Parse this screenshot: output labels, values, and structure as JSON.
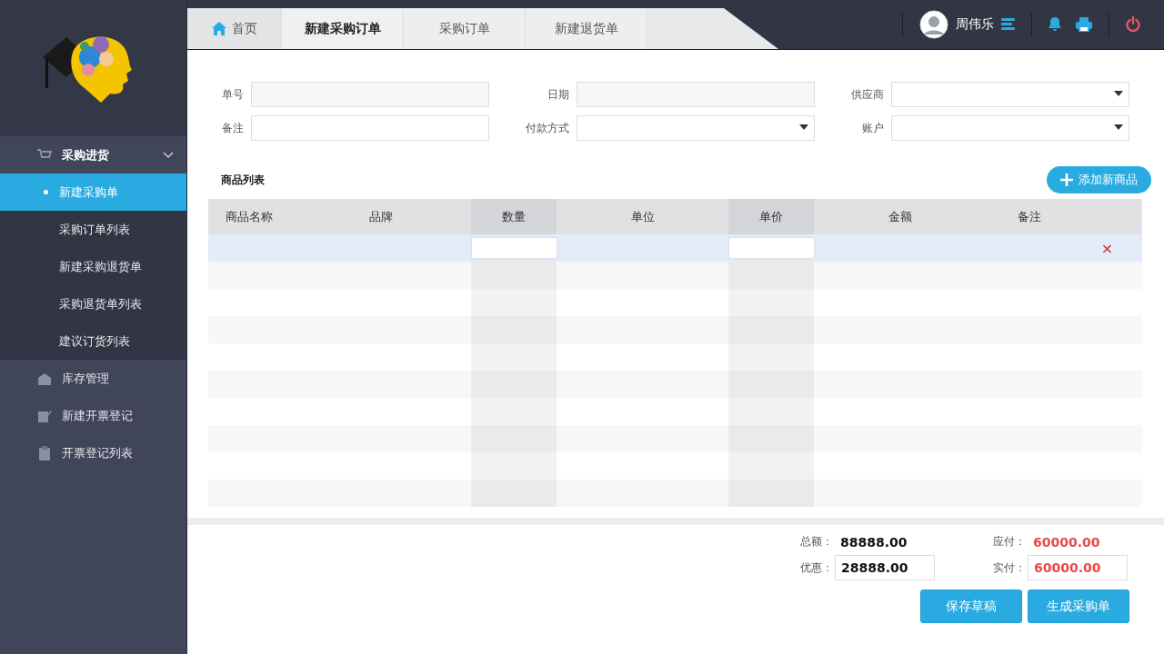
{
  "sidebar": {
    "groups": [
      {
        "label": "采购进货",
        "expanded": true,
        "children": [
          {
            "label": "新建采购单",
            "selected": true
          },
          {
            "label": "采购订单列表",
            "selected": false
          },
          {
            "label": "新建采购退货单",
            "selected": false
          },
          {
            "label": "采购退货单列表",
            "selected": false
          },
          {
            "label": "建议订货列表",
            "selected": false
          }
        ]
      },
      {
        "label": "库存管理",
        "expanded": false
      },
      {
        "label": "新建开票登记",
        "expanded": false
      },
      {
        "label": "开票登记列表",
        "expanded": false
      }
    ]
  },
  "tabs": [
    {
      "label": "首页",
      "kind": "home",
      "selected": false
    },
    {
      "label": "新建采购订单",
      "kind": "plain",
      "selected": true
    },
    {
      "label": "采购订单",
      "kind": "plain",
      "selected": false
    },
    {
      "label": "新建退货单",
      "kind": "plain",
      "selected": false
    }
  ],
  "user": {
    "name": "周伟乐"
  },
  "form": {
    "fields": [
      {
        "label": "单号",
        "kind": "readonly"
      },
      {
        "label": "日期",
        "kind": "readonly"
      },
      {
        "label": "供应商",
        "kind": "select"
      },
      {
        "label": "备注",
        "kind": "text"
      },
      {
        "label": "付款方式",
        "kind": "select"
      },
      {
        "label": "账户",
        "kind": "select"
      }
    ]
  },
  "goods": {
    "title": "商品列表",
    "add_button": "添加新商品",
    "columns": [
      {
        "label": "商品名称",
        "emphasized": false
      },
      {
        "label": "品牌",
        "emphasized": false
      },
      {
        "label": "数量",
        "emphasized": true
      },
      {
        "label": "单位",
        "emphasized": false
      },
      {
        "label": "单价",
        "emphasized": true
      },
      {
        "label": "金额",
        "emphasized": false
      },
      {
        "label": "备注",
        "emphasized": false
      }
    ],
    "rows": [
      {
        "kind": "editable",
        "selected": true,
        "delete": "×"
      },
      {
        "kind": "empty",
        "selected": false
      },
      {
        "kind": "empty",
        "selected": false
      },
      {
        "kind": "empty",
        "selected": false
      },
      {
        "kind": "empty",
        "selected": false
      },
      {
        "kind": "empty",
        "selected": false
      },
      {
        "kind": "empty",
        "selected": false
      },
      {
        "kind": "empty",
        "selected": false
      },
      {
        "kind": "empty",
        "selected": false
      },
      {
        "kind": "empty",
        "selected": false
      }
    ]
  },
  "summary": {
    "total_label": "总额：",
    "total": "88888.00",
    "payable_label": "应付：",
    "payable": "60000.00",
    "discount_label": "优惠：",
    "discount": "28888.00",
    "paid_label": "实付：",
    "paid": "60000.00"
  },
  "buttons": [
    {
      "label": "保存草稿"
    },
    {
      "label": "生成采购单"
    }
  ]
}
